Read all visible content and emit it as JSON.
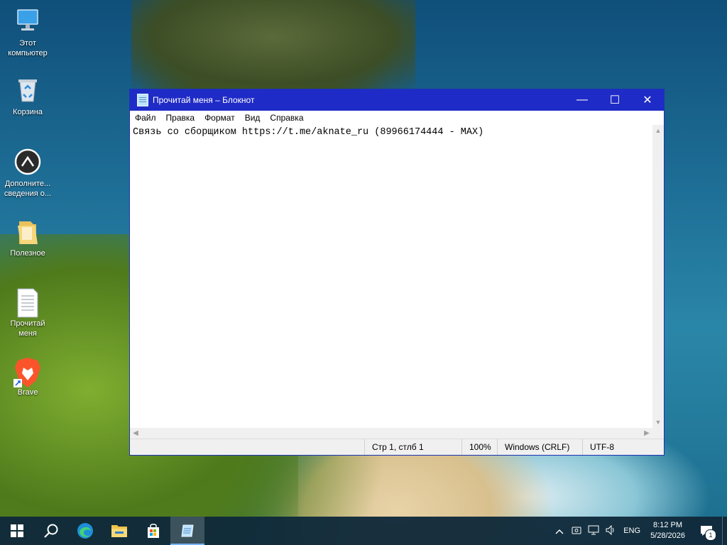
{
  "desktop": {
    "icons": [
      {
        "label": "Этот компьютер"
      },
      {
        "label": "Корзина"
      },
      {
        "label": "Дополните... сведения о..."
      },
      {
        "label": "Полезное"
      },
      {
        "label": "Прочитай меня"
      },
      {
        "label": "Brave"
      }
    ]
  },
  "notepad": {
    "title": "Прочитай меня – Блокнот",
    "menu": [
      "Файл",
      "Правка",
      "Формат",
      "Вид",
      "Справка"
    ],
    "content": "Связь со сборщиком https://t.me/aknate_ru (89966174444 - MAX)",
    "status": {
      "position": "Стр 1, стлб 1",
      "zoom": "100%",
      "line_ending": "Windows (CRLF)",
      "encoding": "UTF-8"
    },
    "controls": {
      "minimize": "—",
      "maximize": "☐",
      "close": "✕"
    }
  },
  "taskbar": {
    "language": "ENG",
    "time": "8:12 PM",
    "date": "5/28/2026",
    "notification_count": "1"
  },
  "colors": {
    "titlebar": "#1f2bc6",
    "taskbar": "#102a3a"
  }
}
